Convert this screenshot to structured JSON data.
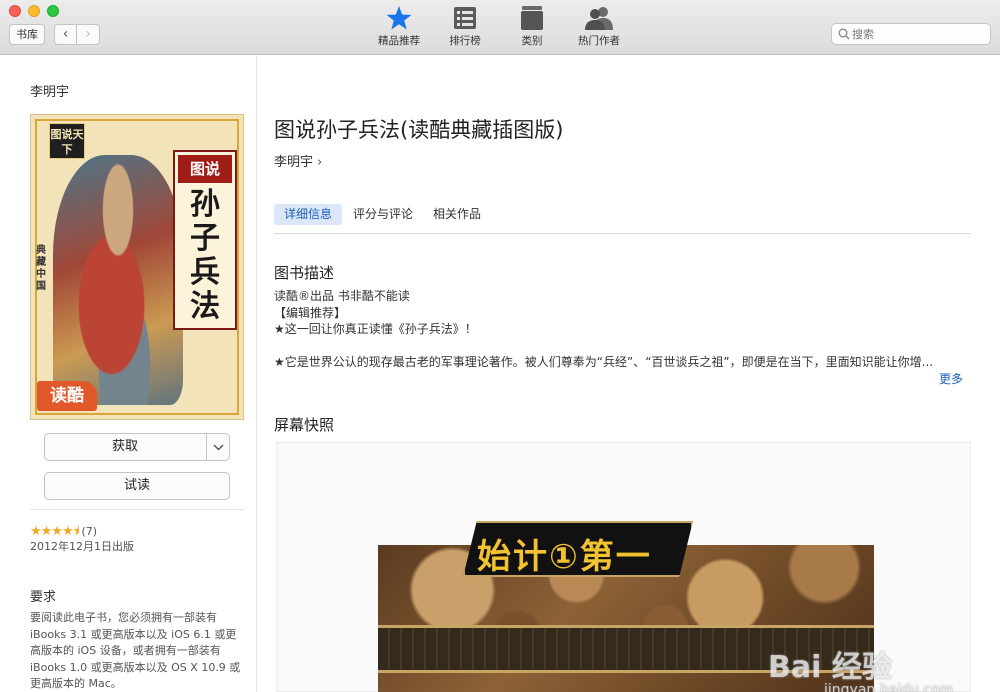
{
  "toolbar": {
    "library_label": "书库",
    "back_glyph": "‹",
    "forward_glyph": "›",
    "tabs": [
      {
        "label": "精品推荐",
        "icon": "star-icon",
        "active": true
      },
      {
        "label": "排行榜",
        "icon": "list-icon",
        "active": false
      },
      {
        "label": "类别",
        "icon": "book-stack-icon",
        "active": false
      },
      {
        "label": "热门作者",
        "icon": "people-icon",
        "active": false
      }
    ],
    "search_placeholder": "搜索"
  },
  "sidebar": {
    "author": "李明宇",
    "cover": {
      "logo_text": "图说天下",
      "side_text": "典藏中国",
      "tag": "图说",
      "title": "孙子兵法",
      "brand": "读酷"
    },
    "get_label": "获取",
    "sample_label": "试读",
    "rating": {
      "stars": "★★★★⯨",
      "value": 4.5,
      "count": "(7)"
    },
    "publish_date": "2012年12月1日出版",
    "requirements_title": "要求",
    "requirements_text": "要阅读此电子书，您必须拥有一部装有 iBooks 3.1 或更高版本以及 iOS 6.1 或更高版本的 iOS 设备，或者拥有一部装有 iBooks 1.0 或更高版本以及 OS X 10.9 或更高版本的 Mac。"
  },
  "main": {
    "title": "图说孙子兵法(读酷典藏插图版)",
    "author": "李明宇",
    "author_chevron": "›",
    "segments": [
      {
        "label": "详细信息",
        "active": true
      },
      {
        "label": "评分与评论",
        "active": false
      },
      {
        "label": "相关作品",
        "active": false
      }
    ],
    "description_heading": "图书描述",
    "description_lines": [
      "读酷®出品 书非酷不能读",
      "【编辑推荐】",
      "★这一回让你真正读懂《孙子兵法》！",
      "★它是世界公认的现存最古老的军事理论著作。被人们尊奉为“兵经”、“百世谈兵之祖”，即便是在当下，里面知识能让你增..."
    ],
    "more_label": "更多",
    "screenshots_heading": "屏幕快照",
    "screenshot_text": "始计①第一"
  },
  "watermark": {
    "logo": "Bai 经验",
    "url": "jingyan.baidu.com"
  },
  "colors": {
    "accent": "#1d5fbf",
    "star": "#f5a623",
    "active_segment_bg": "#dbe7f7"
  }
}
